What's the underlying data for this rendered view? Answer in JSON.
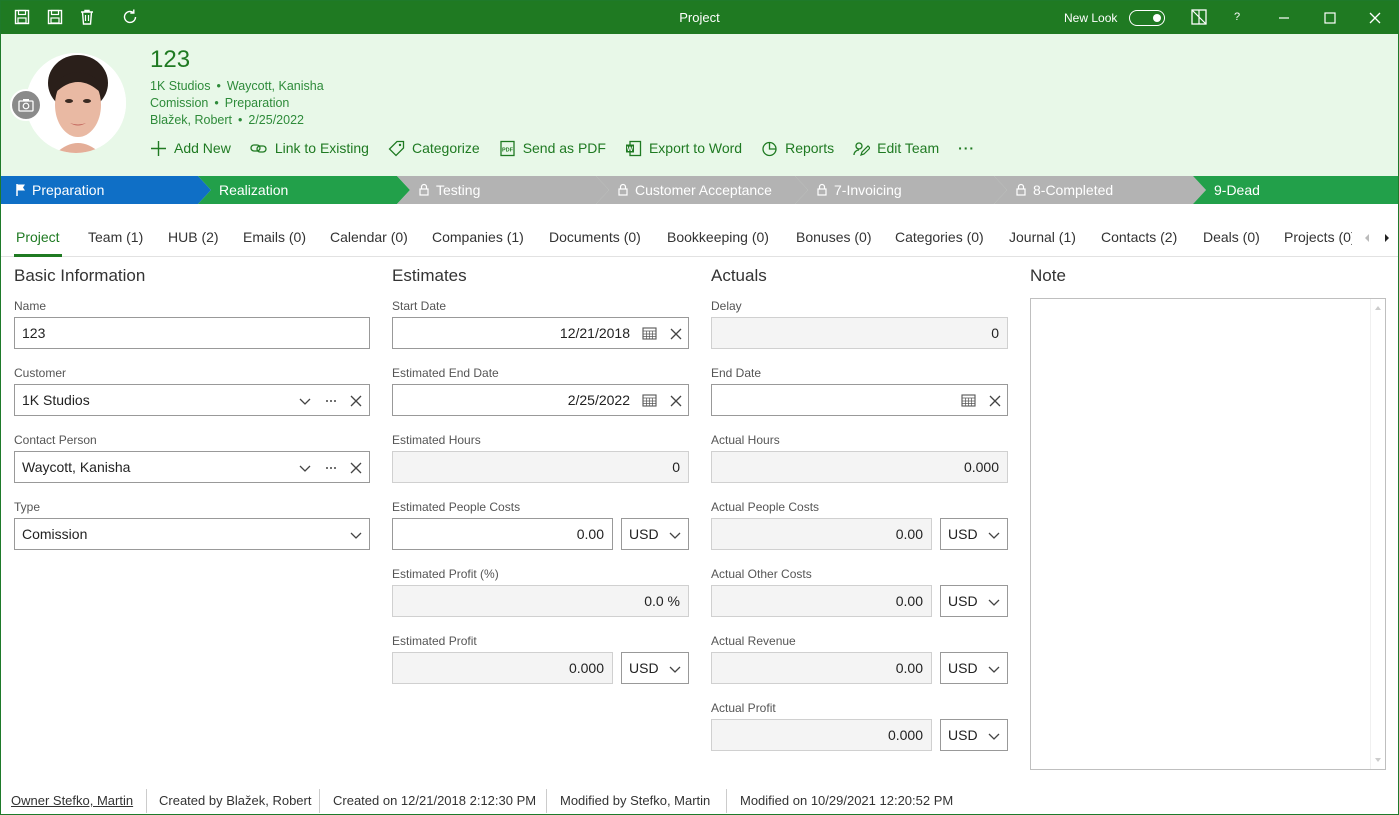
{
  "window": {
    "title": "Project",
    "new_look_label": "New Look",
    "help_label": "?"
  },
  "header": {
    "title": "123",
    "line1": [
      "1K Studios",
      "Waycott, Kanisha"
    ],
    "line2": [
      "Comission",
      "Preparation"
    ],
    "line3": [
      "Blažek, Robert",
      "2/25/2022"
    ],
    "actions": {
      "add_new": "Add New",
      "link_existing": "Link to Existing",
      "categorize": "Categorize",
      "send_pdf": "Send as PDF",
      "export_word": "Export to Word",
      "reports": "Reports",
      "edit_team": "Edit Team",
      "more": "···"
    }
  },
  "stages": [
    {
      "label": "Preparation",
      "state": "current",
      "color": "#0f6fc6"
    },
    {
      "label": "Realization",
      "state": "open",
      "color": "#22a04a"
    },
    {
      "label": "Testing",
      "state": "locked",
      "color": "#b3b3b3"
    },
    {
      "label": "Customer Acceptance",
      "state": "locked",
      "color": "#b3b3b3"
    },
    {
      "label": "7-Invoicing",
      "state": "locked",
      "color": "#b3b3b3"
    },
    {
      "label": "8-Completed",
      "state": "locked",
      "color": "#b3b3b3"
    },
    {
      "label": "9-Dead",
      "state": "open",
      "color": "#22a04a"
    }
  ],
  "tabs": [
    "Project",
    "Team (1)",
    "HUB (2)",
    "Emails (0)",
    "Calendar (0)",
    "Companies (1)",
    "Documents (0)",
    "Bookkeeping (0)",
    "Bonuses (0)",
    "Categories (0)",
    "Journal (1)",
    "Contacts (2)",
    "Deals (0)",
    "Projects (0)"
  ],
  "basic": {
    "title": "Basic Information",
    "name_label": "Name",
    "name_value": "123",
    "customer_label": "Customer",
    "customer_value": "1K Studios",
    "contact_label": "Contact Person",
    "contact_value": "Waycott, Kanisha",
    "type_label": "Type",
    "type_value": "Comission"
  },
  "estimates": {
    "title": "Estimates",
    "start_label": "Start Date",
    "start_value": "12/21/2018",
    "end_label": "Estimated End Date",
    "end_value": "2/25/2022",
    "hours_label": "Estimated Hours",
    "hours_value": "0",
    "people_label": "Estimated People Costs",
    "people_value": "0.00",
    "people_cur": "USD",
    "profit_pct_label": "Estimated Profit (%)",
    "profit_pct_value": "0.0 %",
    "profit_label": "Estimated Profit",
    "profit_value": "0.000",
    "profit_cur": "USD"
  },
  "actuals": {
    "title": "Actuals",
    "delay_label": "Delay",
    "delay_value": "0",
    "end_label": "End Date",
    "end_value": "",
    "hours_label": "Actual Hours",
    "hours_value": "0.000",
    "people_label": "Actual People Costs",
    "people_value": "0.00",
    "people_cur": "USD",
    "other_label": "Actual Other Costs",
    "other_value": "0.00",
    "other_cur": "USD",
    "revenue_label": "Actual Revenue",
    "revenue_value": "0.00",
    "revenue_cur": "USD",
    "profit_label": "Actual Profit",
    "profit_value": "0.000",
    "profit_cur": "USD"
  },
  "note": {
    "title": "Note",
    "value": ""
  },
  "footer": {
    "owner": "Owner Stefko, Martin",
    "created_by": "Created by Blažek, Robert",
    "created_on": "Created on 12/21/2018 2:12:30 PM",
    "modified_by": "Modified by Stefko, Martin",
    "modified_on": "Modified on 10/29/2021 12:20:52 PM"
  }
}
